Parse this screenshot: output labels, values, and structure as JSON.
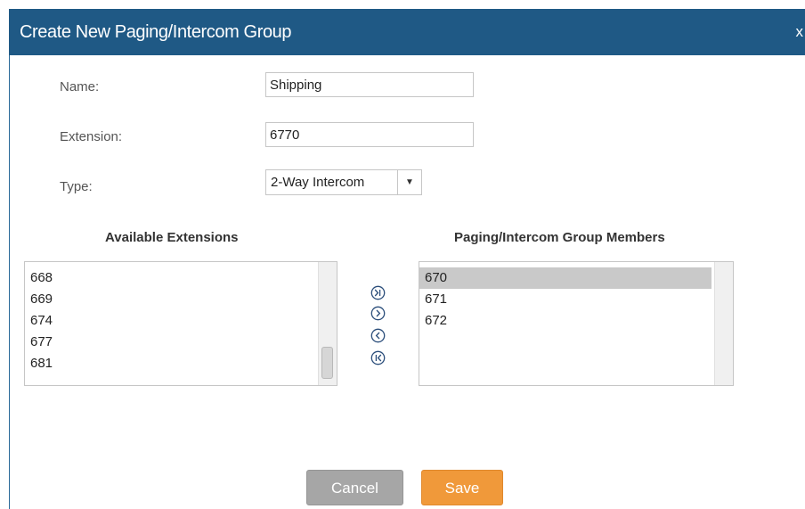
{
  "dialog": {
    "title": "Create New Paging/Intercom Group",
    "close_label": "x"
  },
  "form": {
    "name_label": "Name:",
    "name_value": "Shipping",
    "extension_label": "Extension:",
    "extension_value": "6770",
    "type_label": "Type:",
    "type_value": "2-Way Intercom"
  },
  "available": {
    "heading": "Available Extensions",
    "items": [
      "668",
      "669",
      "674",
      "677",
      "681"
    ]
  },
  "members": {
    "heading": "Paging/Intercom Group Members",
    "items": [
      "670",
      "671",
      "672"
    ],
    "selected_index": 0
  },
  "icons": {
    "add_all": "double-chevron-right-circle-icon",
    "add": "chevron-right-circle-icon",
    "remove": "chevron-left-circle-icon",
    "remove_all": "double-chevron-left-circle-icon"
  },
  "actions": {
    "cancel_label": "Cancel",
    "save_label": "Save"
  },
  "colors": {
    "titlebar": "#1f5985",
    "save": "#f0993a",
    "cancel": "#a6a6a6",
    "selection": "#c9c9c9"
  }
}
